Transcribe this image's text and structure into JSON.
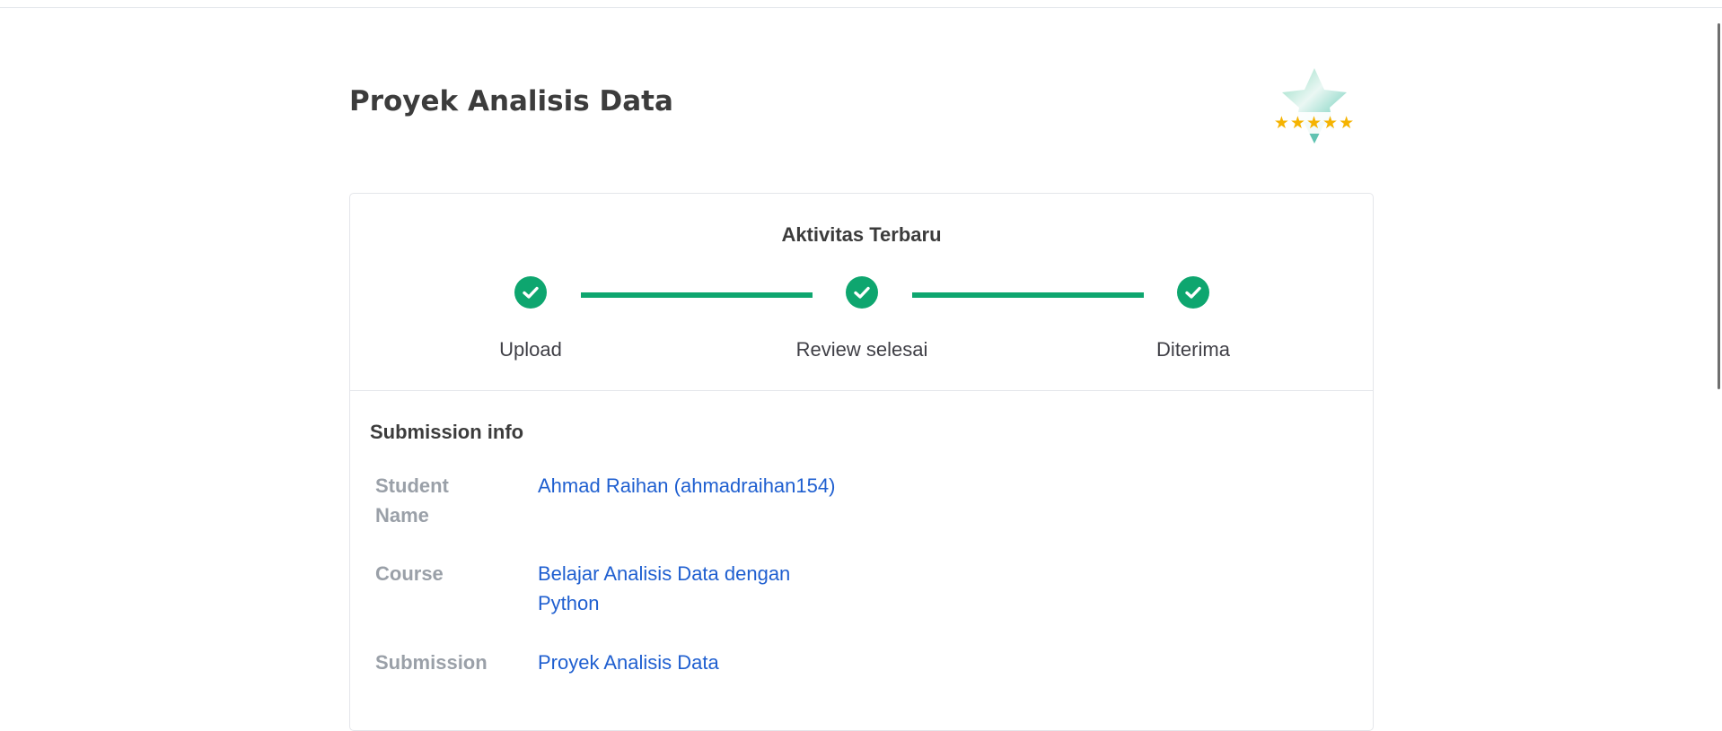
{
  "page": {
    "title": "Proyek Analisis Data"
  },
  "badge": {
    "icon": "star-rating-badge-icon",
    "rating": 5,
    "max_rating": 5
  },
  "activity": {
    "title": "Aktivitas Terbaru",
    "steps": [
      {
        "label": "Upload",
        "status": "done"
      },
      {
        "label": "Review selesai",
        "status": "done"
      },
      {
        "label": "Diterima",
        "status": "done"
      }
    ]
  },
  "submission_info": {
    "title": "Submission info",
    "rows": [
      {
        "label": "Student Name",
        "value": "Ahmad Raihan (ahmadraihan154)"
      },
      {
        "label": "Course",
        "value": "Belajar Analisis Data dengan Python"
      },
      {
        "label": "Submission",
        "value": "Proyek Analisis Data"
      }
    ]
  },
  "colors": {
    "accent": "#0ea66f",
    "link": "#1f5fd0",
    "label": "#9aa0a8",
    "star": "#f5b301"
  }
}
